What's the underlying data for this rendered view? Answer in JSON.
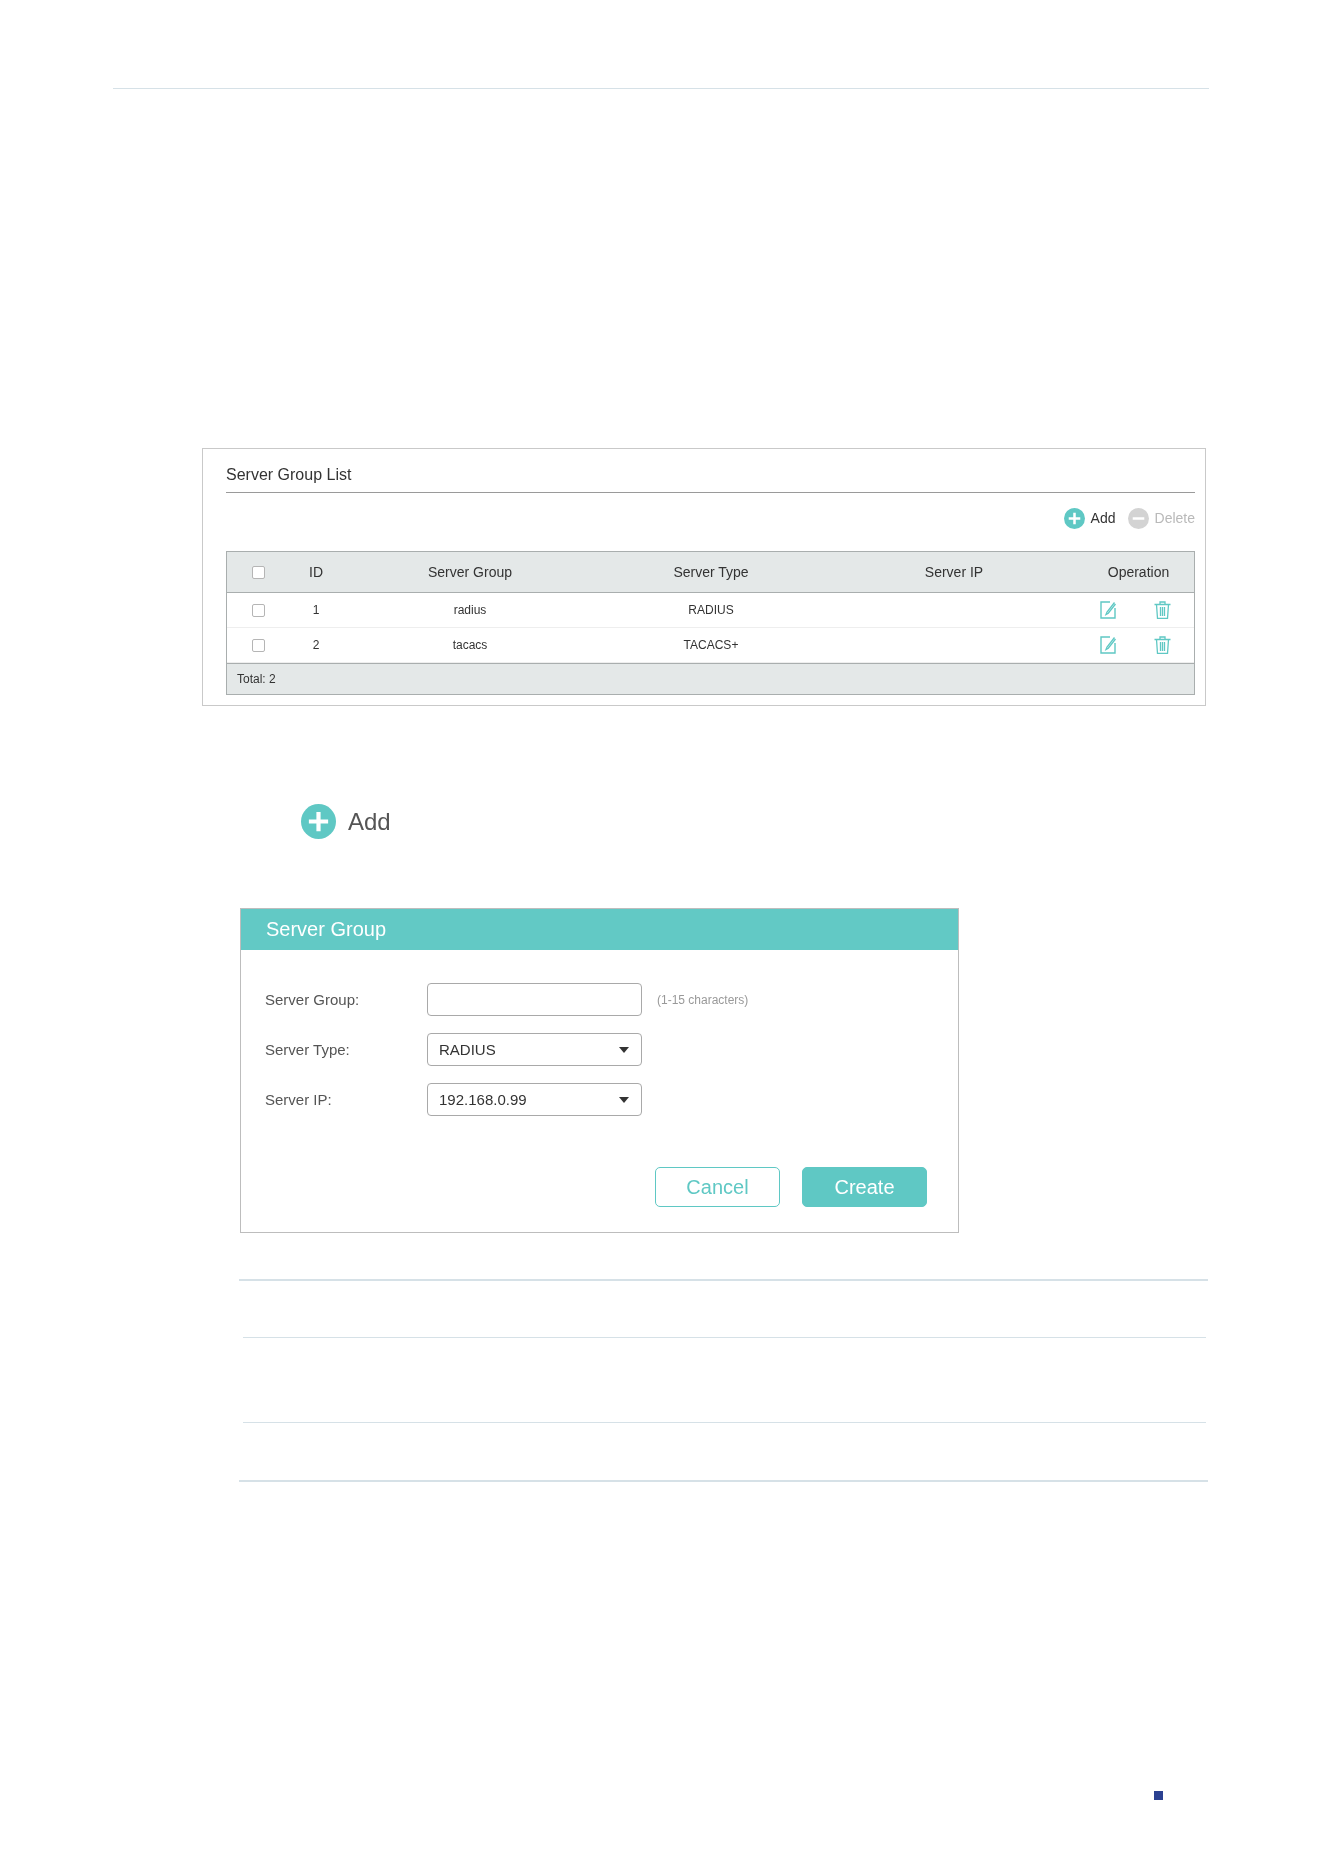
{
  "panel": {
    "title": "Server Group List",
    "toolbar": [
      {
        "kind": "add",
        "label": "Add",
        "disabled": false
      },
      {
        "kind": "delete",
        "label": "Delete",
        "disabled": true
      }
    ],
    "table": {
      "header_checked": false,
      "columns": [
        "ID",
        "Server Group",
        "Server Type",
        "Server IP",
        "Operation"
      ],
      "rows": [
        {
          "checked": false,
          "id": "1",
          "server_group": "radius",
          "server_type": "RADIUS"
        },
        {
          "checked": false,
          "id": "2",
          "server_group": "tacacs",
          "server_type": "TACACS+"
        }
      ],
      "footer": "Total: 2"
    }
  },
  "add_button": {
    "label": "Add"
  },
  "dialog": {
    "title": "Server Group",
    "fields": [
      {
        "kind": "text",
        "label": "Server Group:",
        "hint": "(1-15 characters)"
      },
      {
        "kind": "select",
        "label": "Server Type:",
        "value": "RADIUS"
      },
      {
        "kind": "select",
        "label": "Server IP:",
        "value": "192.168.0.99"
      }
    ],
    "buttons": [
      {
        "kind": "secondary",
        "label": "Cancel"
      },
      {
        "kind": "primary",
        "label": "Create"
      }
    ]
  }
}
